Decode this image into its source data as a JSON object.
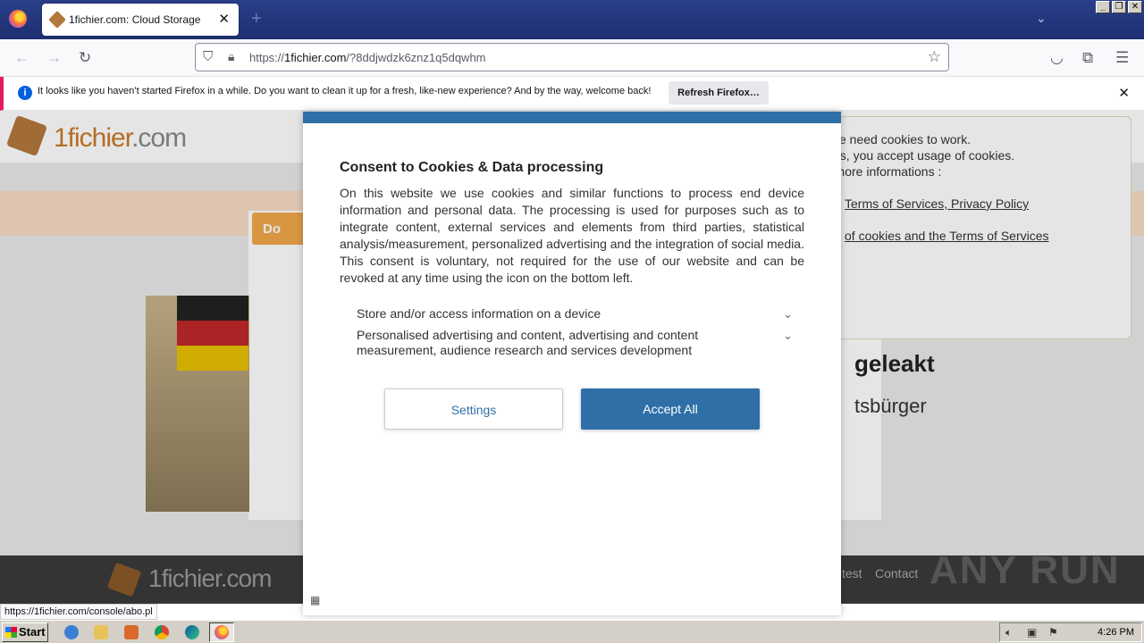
{
  "browser": {
    "tab_title": "1fichier.com: Cloud Storage",
    "url_domain": "1fichier.com",
    "url_prefix": "https://",
    "url_rest": "/?8ddjwdzk6znz1q5dqwhm",
    "notification_text": "It looks like you haven’t started Firefox in a while. Do you want to clean it up for a fresh, like-new experience? And by the way, welcome back!",
    "notification_button": "Refresh Firefox…",
    "status_url": "https://1fichier.com/console/abo.pl"
  },
  "page": {
    "logo_main": "1fichier",
    "logo_suffix": ".com",
    "download_btn": "Do",
    "headline": "geleakt",
    "subheadline": "tsbürger",
    "footer_logo": "1fichier.com",
    "footer_links": [
      "test",
      "Contact"
    ],
    "cookie_lines": [
      "site need cookies to work.",
      "ces, you accept usage of cookies.",
      "r more informations :"
    ],
    "cookie_link1": "Terms of Services, Privacy Policy",
    "cookie_link2": "of cookies and the Terms of Services",
    "watermark": "ANY RUN"
  },
  "modal": {
    "title": "Consent to Cookies & Data processing",
    "body": "On this website we use cookies and similar functions to process end device information and personal data. The processing is used for purposes such as to integrate content, external services and elements from third parties, statistical analysis/measurement, personalized advertising and the integration of social media. This consent is voluntary, not required for the use of our website and can be revoked at any time using the icon on the bottom left.",
    "purposes": [
      "Store and/or access information on a device",
      "Personalised advertising and content, advertising and content measurement, audience research and services development"
    ],
    "settings_button": "Settings",
    "accept_button": "Accept All",
    "accent_color": "#2e6fa7"
  },
  "taskbar": {
    "start_label": "Start",
    "clock": "4:26 PM"
  }
}
